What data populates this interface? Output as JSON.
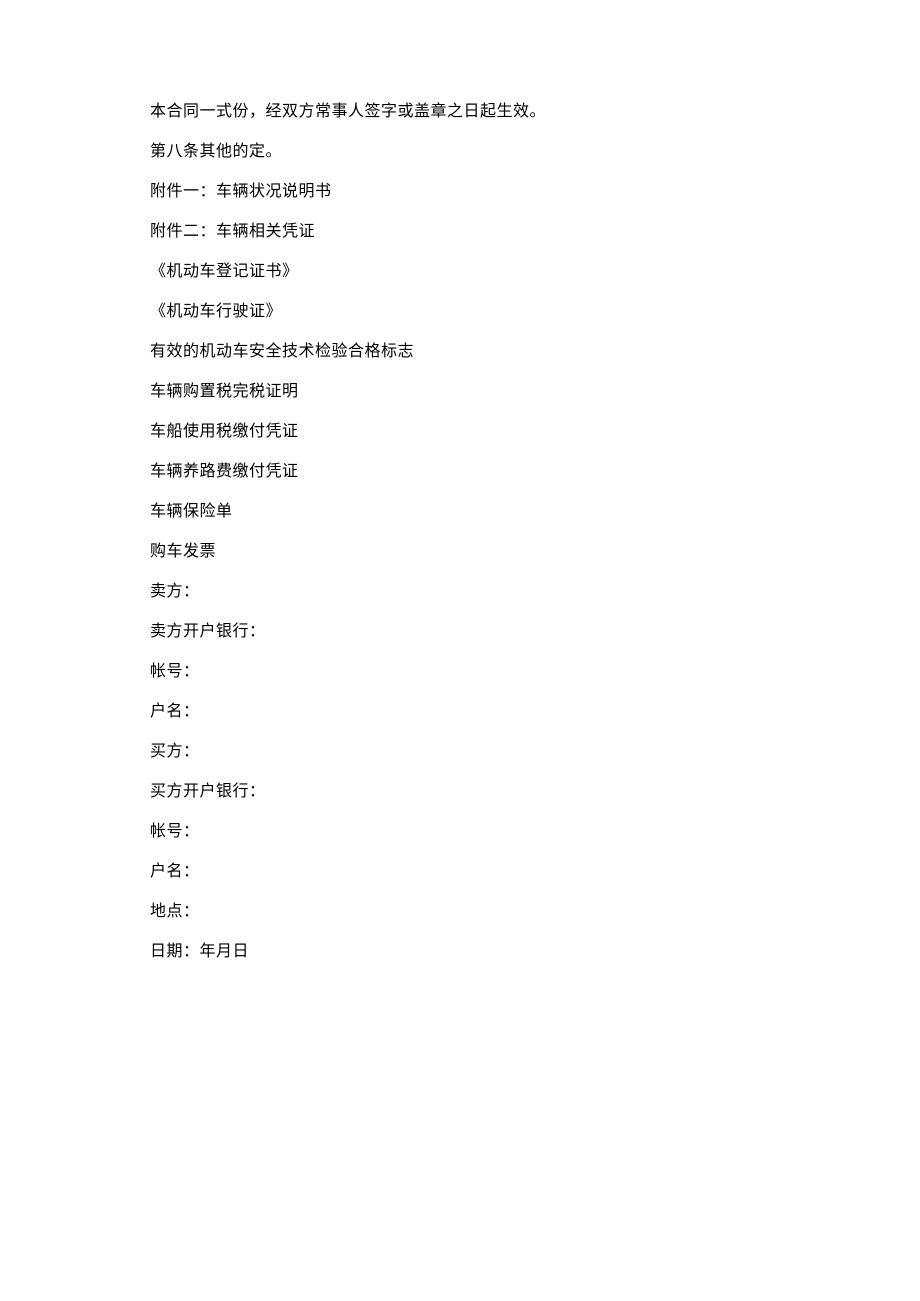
{
  "lines": [
    "本合同一式份，经双方常事人签字或盖章之日起生效。",
    "第八条其他的定。",
    "附件一：车辆状况说明书",
    "附件二：车辆相关凭证",
    "《机动车登记证书》",
    "《机动车行驶证》",
    "有效的机动车安全技术检验合格标志",
    "车辆购置税完税证明",
    "车船使用税缴付凭证",
    "车辆养路费缴付凭证",
    "车辆保险单",
    "购车发票",
    "卖方：",
    "卖方开户银行：",
    "帐号：",
    "户名：",
    "买方：",
    "买方开户银行：",
    "帐号：",
    "户名：",
    "地点：",
    "日期：年月日"
  ]
}
